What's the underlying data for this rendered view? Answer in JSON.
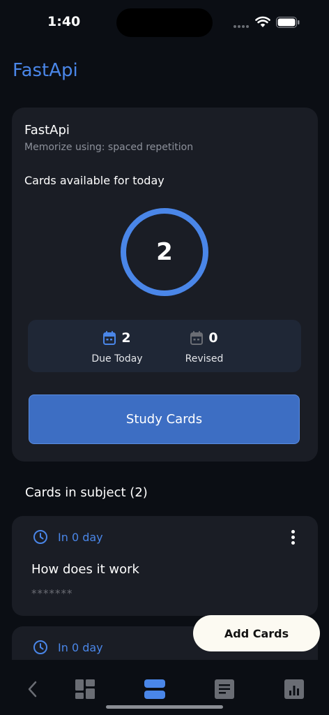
{
  "status_bar": {
    "time": "1:40"
  },
  "header": {
    "title": "FastApi"
  },
  "subject": {
    "name": "FastApi",
    "memorize": "Memorize using: spaced repetition",
    "available_label": "Cards available for today",
    "available_count": "2",
    "stats": [
      {
        "value": "2",
        "label": "Due Today",
        "icon": "calendar-icon",
        "color": "#4a86e8"
      },
      {
        "value": "0",
        "label": "Revised",
        "icon": "calendar-icon",
        "color": "#6a6d74"
      }
    ],
    "study_button": "Study Cards"
  },
  "cards_section": {
    "title": "Cards in subject (2)",
    "cards": [
      {
        "due": "In 0 day",
        "question": "How does it work",
        "answer_mask": "*******"
      },
      {
        "due": "In 0 day",
        "question": "",
        "answer_mask": ""
      }
    ]
  },
  "fab": {
    "label": "Add Cards"
  },
  "nav": {
    "items": [
      {
        "icon": "back-icon"
      },
      {
        "icon": "dashboard-icon"
      },
      {
        "icon": "list-icon",
        "active": true
      },
      {
        "icon": "document-icon"
      },
      {
        "icon": "chart-icon"
      }
    ]
  },
  "colors": {
    "accent": "#4a86e8",
    "card_bg": "#1a1d25",
    "page_bg": "#0b0e14",
    "button": "#3d6ec3"
  }
}
